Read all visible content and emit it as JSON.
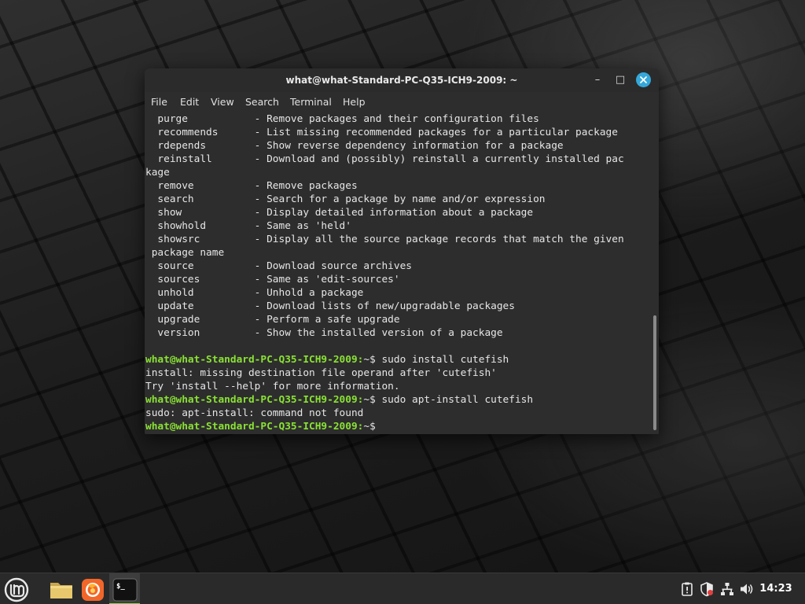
{
  "window": {
    "title": "what@what-Standard-PC-Q35-ICH9-2009: ~",
    "minimize_glyph": "–",
    "maximize_glyph": "□",
    "close_glyph": "✕"
  },
  "menubar": {
    "items": [
      "File",
      "Edit",
      "View",
      "Search",
      "Terminal",
      "Help"
    ]
  },
  "terminal": {
    "lines": [
      {
        "text": "  purge           - Remove packages and their configuration files"
      },
      {
        "text": "  recommends      - List missing recommended packages for a particular package"
      },
      {
        "text": "  rdepends        - Show reverse dependency information for a package"
      },
      {
        "text": "  reinstall       - Download and (possibly) reinstall a currently installed pac"
      },
      {
        "text": "kage"
      },
      {
        "text": "  remove          - Remove packages"
      },
      {
        "text": "  search          - Search for a package by name and/or expression"
      },
      {
        "text": "  show            - Display detailed information about a package"
      },
      {
        "text": "  showhold        - Same as 'held'"
      },
      {
        "text": "  showsrc         - Display all the source package records that match the given"
      },
      {
        "text": " package name"
      },
      {
        "text": "  source          - Download source archives"
      },
      {
        "text": "  sources         - Same as 'edit-sources'"
      },
      {
        "text": "  unhold          - Unhold a package"
      },
      {
        "text": "  update          - Download lists of new/upgradable packages"
      },
      {
        "text": "  upgrade         - Perform a safe upgrade"
      },
      {
        "text": "  version         - Show the installed version of a package"
      },
      {
        "text": ""
      },
      {
        "prompt": "what@what-Standard-PC-Q35-ICH9-2009:",
        "text": "~$ sudo install cutefish"
      },
      {
        "text": "install: missing destination file operand after 'cutefish'"
      },
      {
        "text": "Try 'install --help' for more information."
      },
      {
        "prompt": "what@what-Standard-PC-Q35-ICH9-2009:",
        "text": "~$ sudo apt-install cutefish"
      },
      {
        "text": "sudo: apt-install: command not found"
      },
      {
        "prompt": "what@what-Standard-PC-Q35-ICH9-2009:",
        "text": "~$ "
      }
    ]
  },
  "taskbar": {
    "launchers": [
      "mint-menu-icon",
      "files-folder-icon",
      "firefox-icon",
      "terminal-icon"
    ],
    "terminal_icon_glyph": "$_",
    "tray": [
      "clipboard-icon",
      "update-shield-icon",
      "network-icon",
      "volume-icon"
    ],
    "clock": "14:23"
  },
  "colors": {
    "terminal_bg": "#2d2d2d",
    "prompt_green": "#8ae234",
    "close_button": "#35a8db",
    "firefox_orange": "#f2662a",
    "folder_yellow": "#e7c86c",
    "panel_bg": "#2a2a2a"
  }
}
